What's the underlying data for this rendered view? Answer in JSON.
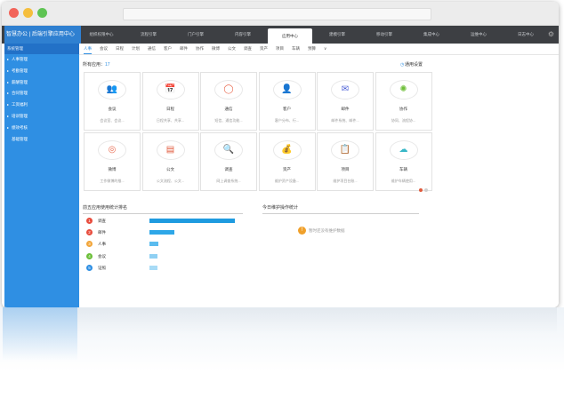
{
  "header": {
    "brand": "智慧办公 | 后端引擎应用中心",
    "nav": [
      "组织权限中心",
      "流程引擎",
      "门户引擎",
      "内容引擎",
      "应用中心",
      "建模引擎",
      "移动引擎",
      "集成中心",
      "运维中心",
      "日志中心"
    ],
    "active_nav": "应用中心"
  },
  "sidebar": {
    "section": "系统管理",
    "items": [
      "人事管理",
      "考勤管理",
      "薪酬管理",
      "合同管理",
      "工资福利",
      "培训管理",
      "绩效考核",
      "基础管理"
    ]
  },
  "tabs": [
    "人事",
    "会议",
    "日程",
    "计划",
    "通信",
    "客户",
    "邮件",
    "协作",
    "微博",
    "公文",
    "调查",
    "资产",
    "项目",
    "车辆",
    "预算",
    "∨"
  ],
  "apps": {
    "label": "所有应用：",
    "count": "17",
    "settings": "通用设置",
    "cards": [
      {
        "icon": "meeting-icon",
        "glyph": "👥",
        "color": "#6fbf3a",
        "name": "会议",
        "desc": "会议室、会议..."
      },
      {
        "icon": "calendar-icon",
        "glyph": "📅",
        "color": "#2f8fe3",
        "name": "日程",
        "desc": "日程共享、共享..."
      },
      {
        "icon": "chat-icon",
        "glyph": "◯",
        "color": "#e96a4f",
        "name": "通信",
        "desc": "短信、通信功能..."
      },
      {
        "icon": "customer-icon",
        "glyph": "👤",
        "color": "#e05a3c",
        "name": "客户",
        "desc": "客户分布、行..."
      },
      {
        "icon": "mail-icon",
        "glyph": "✉",
        "color": "#4b5fd6",
        "name": "邮件",
        "desc": "邮件系统、邮件..."
      },
      {
        "icon": "collaboration-icon",
        "glyph": "✺",
        "color": "#6fbf3a",
        "name": "协作",
        "desc": "协同、流程协..."
      },
      {
        "icon": "weibo-icon",
        "glyph": "◎",
        "color": "#e96a4f",
        "name": "微博",
        "desc": "工作微博的推..."
      },
      {
        "icon": "document-icon",
        "glyph": "▤",
        "color": "#e05a3c",
        "name": "公文",
        "desc": "公文流程、公文..."
      },
      {
        "icon": "survey-icon",
        "glyph": "🔍",
        "color": "#6fbf3a",
        "name": "调查",
        "desc": "网上调查系统..."
      },
      {
        "icon": "assets-icon",
        "glyph": "💰",
        "color": "#2f8fe3",
        "name": "资产",
        "desc": "维护资产设备..."
      },
      {
        "icon": "project-icon",
        "glyph": "📋",
        "color": "#2f8fe3",
        "name": "项目",
        "desc": "维护项目台账..."
      },
      {
        "icon": "vehicle-icon",
        "glyph": "☁",
        "color": "#38b7c7",
        "name": "车辆",
        "desc": "维护车辆使用..."
      }
    ],
    "pager_colors": [
      "#e05a3c",
      "#d0d0d0"
    ]
  },
  "ranking": {
    "title": "前五应用使用统计排名",
    "rows": [
      {
        "rank": "1",
        "name": "调查",
        "value": 1.0,
        "badge_color": "#e84c3d",
        "bar_color": "#1f9be0"
      },
      {
        "rank": "2",
        "name": "邮件",
        "value": 0.29,
        "badge_color": "#e84c3d",
        "bar_color": "#2ea7e8"
      },
      {
        "rank": "3",
        "name": "人事",
        "value": 0.1,
        "badge_color": "#f2a53a",
        "bar_color": "#5bbcef"
      },
      {
        "rank": "4",
        "name": "会议",
        "value": 0.09,
        "badge_color": "#6cbf3a",
        "bar_color": "#8fd0f3"
      },
      {
        "rank": "5",
        "name": "证照",
        "value": 0.09,
        "badge_color": "#2f8fe3",
        "bar_color": "#a8dbf6"
      }
    ]
  },
  "ops": {
    "title": "今日维护操作统计",
    "empty_text": "暂时还没有维护数据"
  }
}
